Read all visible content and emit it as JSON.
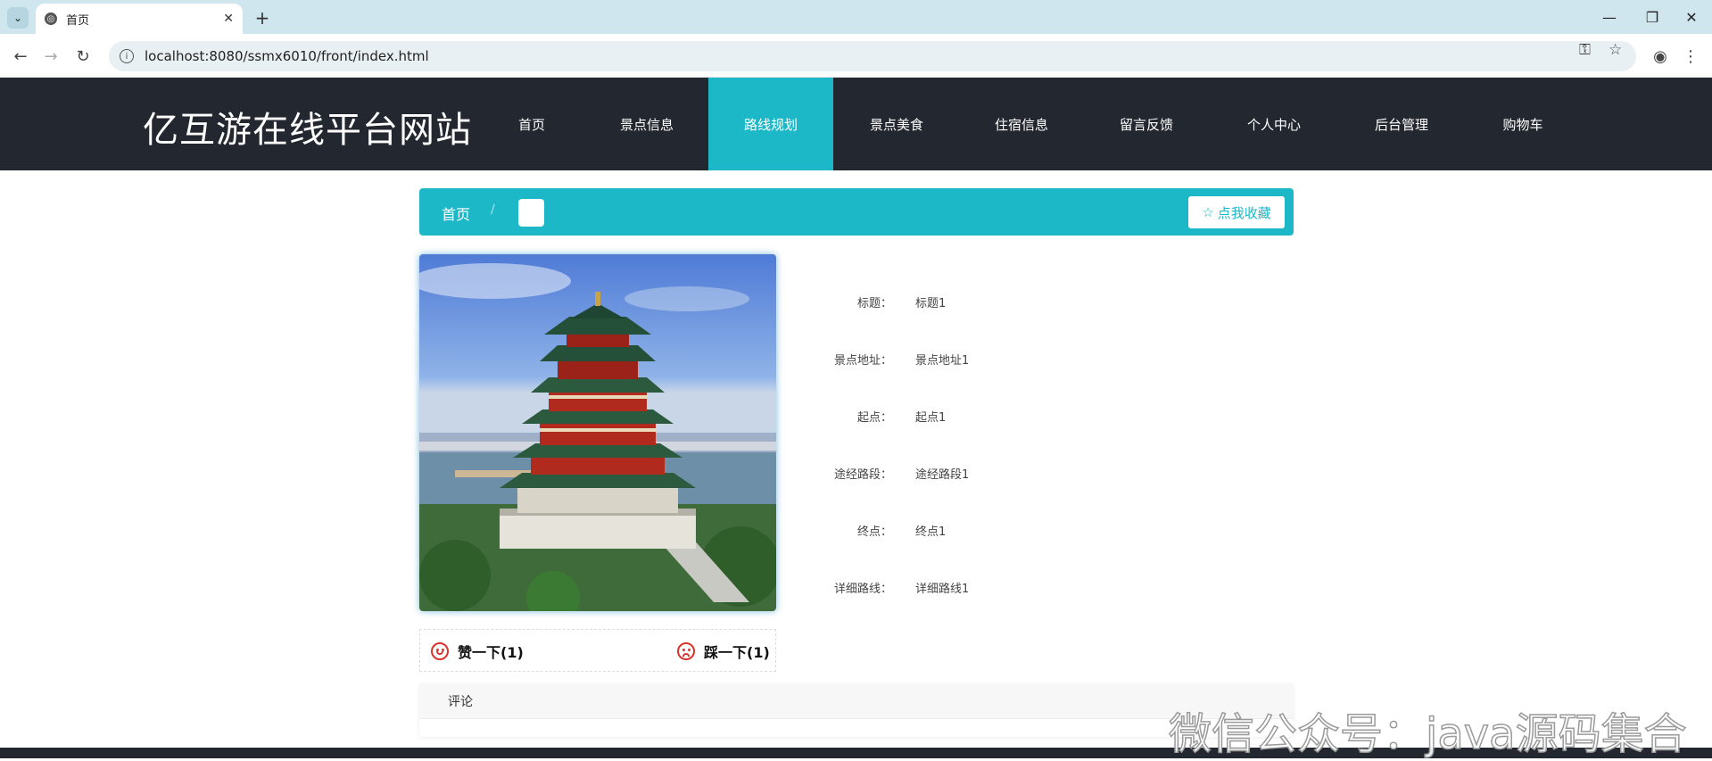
{
  "browser": {
    "tab_title": "首页",
    "url": "localhost:8080/ssmx6010/front/index.html"
  },
  "site": {
    "title": "亿互游在线平台网站",
    "nav": [
      {
        "label": "首页",
        "active": false
      },
      {
        "label": "景点信息",
        "active": false
      },
      {
        "label": "路线规划",
        "active": true
      },
      {
        "label": "景点美食",
        "active": false
      },
      {
        "label": "住宿信息",
        "active": false
      },
      {
        "label": "留言反馈",
        "active": false
      },
      {
        "label": "个人中心",
        "active": false
      },
      {
        "label": "后台管理",
        "active": false
      },
      {
        "label": "购物车",
        "active": false
      }
    ]
  },
  "breadcrumb": {
    "home": "首页",
    "separator": "/",
    "favorite_label": "点我收藏"
  },
  "detail": {
    "fields": [
      {
        "label": "标题：",
        "value": "标题1"
      },
      {
        "label": "景点地址：",
        "value": "景点地址1"
      },
      {
        "label": "起点：",
        "value": "起点1"
      },
      {
        "label": "途经路段：",
        "value": "途经路段1"
      },
      {
        "label": "终点：",
        "value": "终点1"
      },
      {
        "label": "详细路线：",
        "value": "详细路线1"
      }
    ]
  },
  "votes": {
    "like_label": "赞一下(1)",
    "dislike_label": "踩一下(1)"
  },
  "comments": {
    "title": "评论"
  },
  "watermark": "微信公众号：java源码集合",
  "colors": {
    "header_bg": "#23272f",
    "accent": "#1cb8c8",
    "vote_icon": "#d9342b"
  }
}
